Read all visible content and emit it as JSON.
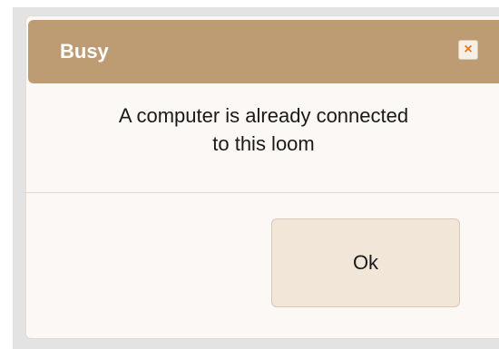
{
  "dialog": {
    "title": "Busy",
    "close_label": "×",
    "message_line1": "A computer is already connected",
    "message_line2": "to this loom",
    "ok_label": "Ok"
  },
  "colors": {
    "titlebar": "#bd9b73",
    "close_glyph": "#e8761c",
    "button_bg": "#f1e6d8",
    "dialog_bg": "#fbf8f5"
  },
  "icons": {
    "close": "close-icon"
  }
}
